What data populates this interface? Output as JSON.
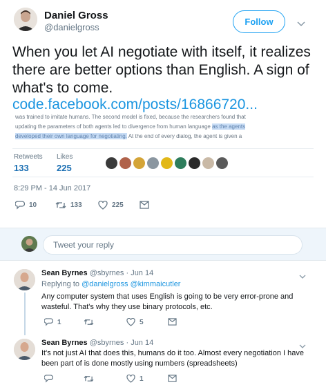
{
  "main_tweet": {
    "author_name": "Daniel Gross",
    "author_handle": "@danielgross",
    "follow_label": "Follow",
    "text": "When you let AI negotiate with itself, it realizes there are better options than English. A sign of what's to come.",
    "link": "code.facebook.com/posts/16866720...",
    "quote": {
      "line1": "was trained to imitate humans. The second model is fixed, because the researchers found that",
      "line2_pre": "updating the parameters of both agents led to divergence from human language ",
      "line2_hl": "as the agents",
      "line3_hl": "developed their own language for negotiating.",
      "line3_post": " At the end of every dialog, the agent is given a"
    },
    "stats": {
      "retweets_label": "Retweets",
      "retweets": "133",
      "likes_label": "Likes",
      "likes": "225"
    },
    "timestamp": "8:29 PM - 14 Jun 2017",
    "actions": {
      "replies": "10",
      "retweets": "133",
      "likes": "225"
    }
  },
  "reply_composer": {
    "placeholder": "Tweet your reply"
  },
  "replies": [
    {
      "name": "Sean Byrnes",
      "handle": "@sbyrnes",
      "date": "· Jun 14",
      "replying_prefix": "Replying to ",
      "replying_to": "@danielgross @kimmaicutler",
      "text_line1": "Any computer system that uses English is going to be very error-prone and",
      "text_line2": "wasteful. That's why they use binary protocols, etc.",
      "replies": "1",
      "retweets": "",
      "likes": "5"
    },
    {
      "name": "Sean Byrnes",
      "handle": "@sbyrnes",
      "date": "· Jun 14",
      "text_line1": "It's not just AI that does this, humans do it too. Almost every negotiation I have",
      "text_line2": "been part of is done mostly using numbers (spreadsheets)",
      "replies": "",
      "retweets": "",
      "likes": "1"
    }
  ],
  "colors": {
    "brand": "#1da1f2",
    "link": "#1b95e0",
    "highlight": "#c7dcf5"
  },
  "icons": [
    "reply-icon",
    "retweet-icon",
    "like-icon",
    "message-icon",
    "chevron-down-icon"
  ]
}
